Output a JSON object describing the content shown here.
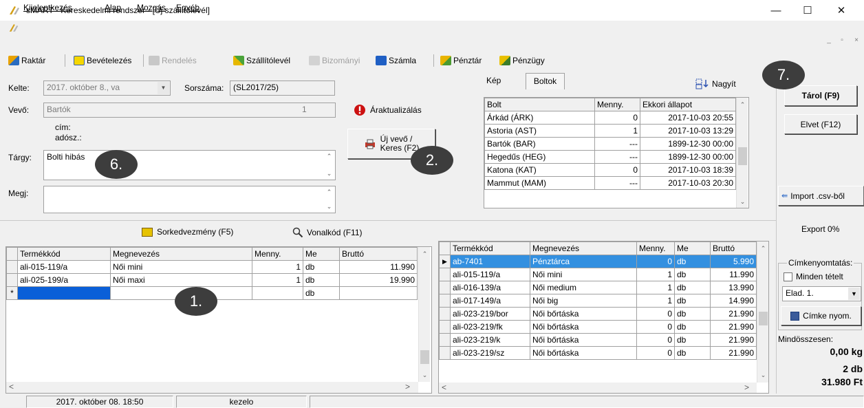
{
  "window": {
    "title": "sMART  -  Kereskedelmi rendszer - [Új szállítólevél]",
    "minimize": "—",
    "maximize": "☐",
    "close": "✕"
  },
  "menu": {
    "items": [
      "Kijelentkezés",
      "Alap",
      "Mozgás",
      "Egyéb"
    ],
    "mdi": [
      "_",
      "▫",
      "×"
    ]
  },
  "toolbar": {
    "raktar": "Raktár",
    "bevetelezes": "Bevételezés",
    "rendeles": "Rendelés",
    "szallitolevel": "Szállítólevél",
    "bizomanyi": "Bizományi",
    "szamla": "Számla",
    "penztar": "Pénztár",
    "penzugy": "Pénzügy"
  },
  "form": {
    "kelte_label": "Kelte:",
    "kelte_value": "2017.   október    8., va",
    "sorszama_label": "Sorszáma:",
    "sorszama_value": "(SL2017/25)",
    "vevo_label": "Vevő:",
    "vevo_value": "Bartók",
    "vevo_code": "1",
    "cim_label": "cím:",
    "adosz_label": "adósz.:",
    "targy_label": "Tárgy:",
    "targy_value": "Bolti hibás",
    "megj_label": "Megj:",
    "megj_value": ""
  },
  "actions": {
    "araktualizalas": "Áraktualizálás",
    "uj_vevo_line1": "Új vevő /",
    "uj_vevo_line2": "Keres (F2)",
    "sorkedvezmeny": "Sorkedvezmény (F5)",
    "vonalkod": "Vonalkód (F11)"
  },
  "stores": {
    "tabs": [
      "Kép",
      "Boltok"
    ],
    "nagyit": "Nagyít",
    "headers": [
      "Bolt",
      "Menny.",
      "Ekkori állapot"
    ],
    "rows": [
      [
        "Árkád (ÁRK)",
        "0",
        "2017-10-03  20:55"
      ],
      [
        "Astoria (AST)",
        "1",
        "2017-10-03  13:29"
      ],
      [
        "Bartók (BAR)",
        "---",
        "1899-12-30  00:00"
      ],
      [
        "Hegedűs (HEG)",
        "---",
        "1899-12-30  00:00"
      ],
      [
        "Katona (KAT)",
        "0",
        "2017-10-03  18:39"
      ],
      [
        "Mammut (MAM)",
        "---",
        "2017-10-03  20:30"
      ]
    ]
  },
  "right_panel": {
    "tarol": "Tárol (F9)",
    "elvet": "Elvet (F12)",
    "import_csv": "Import .csv-ből",
    "export": "Export 0%",
    "cimke_group": "Címkenyomtatás:",
    "minden_tetelt": "Minden tételt",
    "elad_select": "Elad. 1.",
    "cimke_nyom": "Címke nyom.",
    "mindosszesen": "Mindösszesen:",
    "total_kg": "0,00 kg",
    "total_db": "2 db",
    "total_ft": "31.980 Ft"
  },
  "items_grid": {
    "headers": [
      "Termékkód",
      "Megnevezés",
      "Menny.",
      "Me",
      "Bruttó"
    ],
    "rows": [
      [
        "ali-015-119/a",
        "Női mini",
        "1",
        "db",
        "11.990"
      ],
      [
        "ali-025-199/a",
        "Női maxi",
        "1",
        "db",
        "19.990"
      ]
    ],
    "new_row_marker": "*",
    "new_row_unit": "db"
  },
  "products_grid": {
    "headers": [
      "Termékkód",
      "Megnevezés",
      "Menny.",
      "Me",
      "Bruttó"
    ],
    "rows": [
      [
        "ab-7401",
        "Pénztárca",
        "0",
        "db",
        "5.990"
      ],
      [
        "ali-015-119/a",
        "Női mini",
        "1",
        "db",
        "11.990"
      ],
      [
        "ali-016-139/a",
        "Női medium",
        "1",
        "db",
        "13.990"
      ],
      [
        "ali-017-149/a",
        "Női big",
        "1",
        "db",
        "14.990"
      ],
      [
        "ali-023-219/bor",
        "Női bőrtáska",
        "0",
        "db",
        "21.990"
      ],
      [
        "ali-023-219/fk",
        "Női bőrtáska",
        "0",
        "db",
        "21.990"
      ],
      [
        "ali-023-219/k",
        "Női bőrtáska",
        "0",
        "db",
        "21.990"
      ],
      [
        "ali-023-219/sz",
        "Női bőrtáska",
        "0",
        "db",
        "21.990"
      ]
    ]
  },
  "callouts": [
    "1.",
    "2.",
    "6.",
    "7."
  ],
  "status": {
    "date": "2017. október 08.  18:50",
    "user": "kezelo"
  },
  "colors": {
    "selection": "#3390e0",
    "callout": "#3d3d3d",
    "warning_icon": "#cc1111"
  }
}
